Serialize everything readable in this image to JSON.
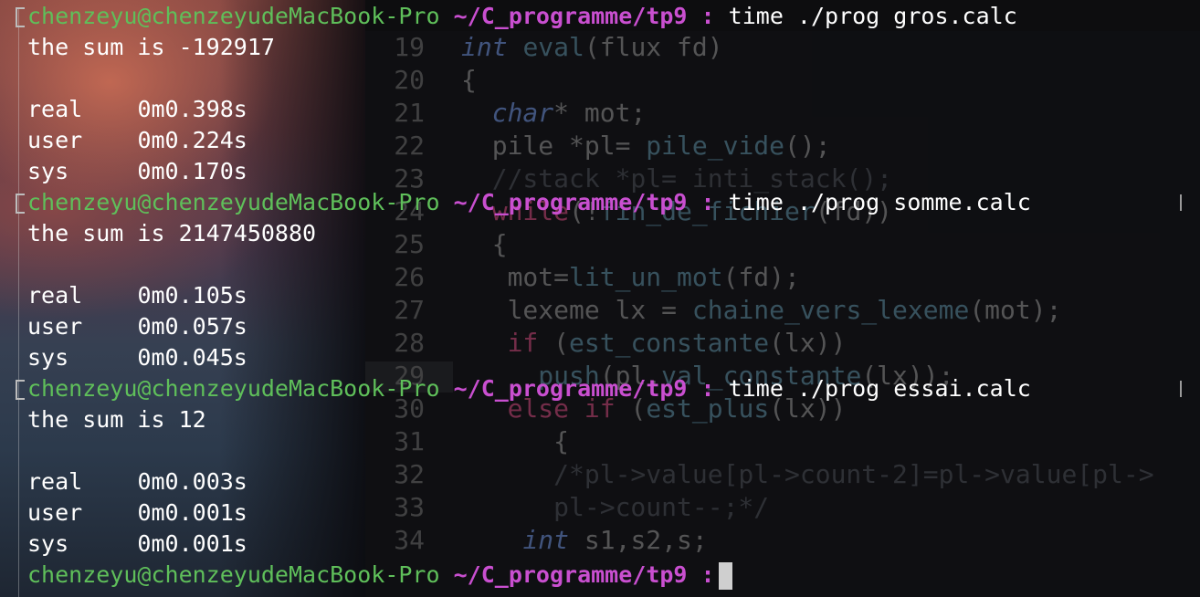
{
  "prompt": {
    "user_host": "chenzeyu@chenzeyudeMacBook-Pro",
    "path": "~/C_programme/tp9",
    "sep": ":"
  },
  "runs": [
    {
      "command": "time ./prog gros.calc",
      "output": "the sum is -192917",
      "real_label": "real",
      "real": "0m0.398s",
      "user_label": "user",
      "user": "0m0.224s",
      "sys_label": "sys",
      "sys": "0m0.170s"
    },
    {
      "command": "time ./prog somme.calc",
      "output": "the sum is 2147450880",
      "real_label": "real",
      "real": "0m0.105s",
      "user_label": "user",
      "user": "0m0.057s",
      "sys_label": "sys",
      "sys": "0m0.045s"
    },
    {
      "command": "time ./prog essai.calc",
      "output": "the sum is 12",
      "real_label": "real",
      "real": "0m0.003s",
      "user_label": "user",
      "user": "0m0.001s",
      "sys_label": "sys",
      "sys": "0m0.001s"
    }
  ],
  "editor": {
    "lines": [
      {
        "n": "19",
        "text": "int eval(flux fd)"
      },
      {
        "n": "20",
        "text": "{"
      },
      {
        "n": "21",
        "text": "  char* mot;"
      },
      {
        "n": "22",
        "text": "  pile *pl= pile_vide();"
      },
      {
        "n": "23",
        "text": "  //stack *pl= inti_stack();"
      },
      {
        "n": "24",
        "text": "  while(!fin_de_fichier(fd))"
      },
      {
        "n": "25",
        "text": "  {"
      },
      {
        "n": "26",
        "text": "   mot=lit_un_mot(fd);"
      },
      {
        "n": "27",
        "text": "   lexeme lx = chaine_vers_lexeme(mot);"
      },
      {
        "n": "28",
        "text": "   if (est_constante(lx))"
      },
      {
        "n": "29",
        "text": "     push(pl,val_constante(lx));"
      },
      {
        "n": "30",
        "text": "   else if (est_plus(lx))"
      },
      {
        "n": "31",
        "text": "      {"
      },
      {
        "n": "32",
        "text": "      /*pl->value[pl->count-2]=pl->value[pl->"
      },
      {
        "n": "33",
        "text": "      pl->count--;*/"
      },
      {
        "n": "34",
        "text": "    int s1,s2,s;"
      }
    ]
  },
  "colors": {
    "user_host": "#5fbf5a",
    "path": "#c94fd0",
    "text": "#ffffff",
    "cursor": "#cfcfcf"
  }
}
